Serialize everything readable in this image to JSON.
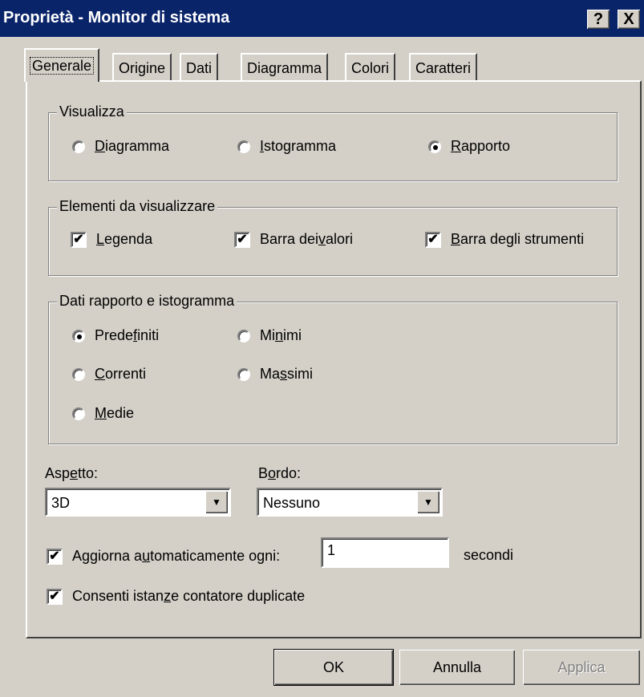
{
  "window": {
    "title": "Proprietà - Monitor di sistema",
    "help_label": "?",
    "close_label": "X"
  },
  "tabs": [
    {
      "label": "Generale",
      "active": true
    },
    {
      "label": "Origine"
    },
    {
      "label": "Dati"
    },
    {
      "label": "Diagramma"
    },
    {
      "label": "Colori"
    },
    {
      "label": "Caratteri"
    }
  ],
  "visualizza": {
    "legend": "Visualizza",
    "options": [
      {
        "pre": "",
        "key": "D",
        "post": "iagramma",
        "selected": false
      },
      {
        "pre": "",
        "key": "I",
        "post": "stogramma",
        "selected": false
      },
      {
        "pre": "",
        "key": "R",
        "post": "apporto",
        "selected": true
      }
    ]
  },
  "elementi": {
    "legend": "Elementi da visualizzare",
    "options": [
      {
        "pre": "",
        "key": "L",
        "post": "egenda",
        "checked": true
      },
      {
        "pre": "Barra dei ",
        "key": "v",
        "post": "alori",
        "checked": true
      },
      {
        "pre": "",
        "key": "B",
        "post": "arra degli strumenti",
        "checked": true
      }
    ]
  },
  "dati_rapporto": {
    "legend": "Dati rapporto e istogramma",
    "options": [
      {
        "pre": "Prede",
        "key": "f",
        "post": "initi",
        "selected": true
      },
      {
        "pre": "Mi",
        "key": "n",
        "post": "imi",
        "selected": false
      },
      {
        "pre": "",
        "key": "C",
        "post": "orrenti",
        "selected": false
      },
      {
        "pre": "Ma",
        "key": "s",
        "post": "simi",
        "selected": false
      },
      {
        "pre": "",
        "key": "M",
        "post": "edie",
        "selected": false
      }
    ]
  },
  "aspetto": {
    "label_pre": "Asp",
    "label_key": "e",
    "label_post": "tto:",
    "value": "3D"
  },
  "bordo": {
    "label_pre": "B",
    "label_key": "o",
    "label_post": "rdo:",
    "value": "Nessuno"
  },
  "aggiorna": {
    "pre": "Aggiorna a",
    "key": "u",
    "post": "tomaticamente ogni:",
    "checked": true,
    "value": "1",
    "unit": "secondi"
  },
  "consenti": {
    "pre": "Consenti istan",
    "key": "z",
    "post": "e contatore duplicate",
    "checked": true
  },
  "buttons": {
    "ok": "OK",
    "annulla": "Annulla",
    "applica": "Applica"
  },
  "colors": {
    "titlebar": "#0a246a",
    "face": "#d4d0c8"
  },
  "check_glyph": "✔",
  "arrow_glyph": "▼"
}
